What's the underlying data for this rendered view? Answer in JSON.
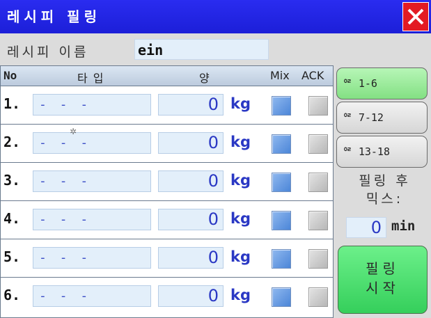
{
  "window": {
    "title": "레시피 필링"
  },
  "recipe": {
    "name_label": "레시피 이름",
    "name_value": "ein"
  },
  "table": {
    "headers": {
      "no": "No",
      "type": "타입",
      "amount": "양",
      "mix": "Mix",
      "ack": "ACK"
    },
    "rows": [
      {
        "no": "1.",
        "type": "- - -",
        "amount": "0",
        "unit": "kg",
        "mix": true,
        "ack": false
      },
      {
        "no": "2.",
        "type": "- - -",
        "amount": "0",
        "unit": "kg",
        "mix": true,
        "ack": false
      },
      {
        "no": "3.",
        "type": "- - -",
        "amount": "0",
        "unit": "kg",
        "mix": true,
        "ack": false
      },
      {
        "no": "4.",
        "type": "- - -",
        "amount": "0",
        "unit": "kg",
        "mix": true,
        "ack": false
      },
      {
        "no": "5.",
        "type": "- - -",
        "amount": "0",
        "unit": "kg",
        "mix": true,
        "ack": false
      },
      {
        "no": "6.",
        "type": "- - -",
        "amount": "0",
        "unit": "kg",
        "mix": true,
        "ack": false
      }
    ]
  },
  "side": {
    "page_buttons": [
      {
        "label": "ᄋᄅ 1-6",
        "active": true
      },
      {
        "label": "ᄋᄅ 7-12",
        "active": false
      },
      {
        "label": "ᄋᄅ 13-18",
        "active": false
      }
    ],
    "mix_after_label_line1": "필링 후",
    "mix_after_label_line2": "믹스:",
    "mix_minutes": "0",
    "mix_unit": "min",
    "start_label_line1": "필링",
    "start_label_line2": "시작"
  },
  "colors": {
    "titlebar": "#1c1fd8",
    "close": "#e31b23",
    "active_page": "#9ff09f",
    "start": "#44d866",
    "value_blue": "#2a38c4"
  }
}
